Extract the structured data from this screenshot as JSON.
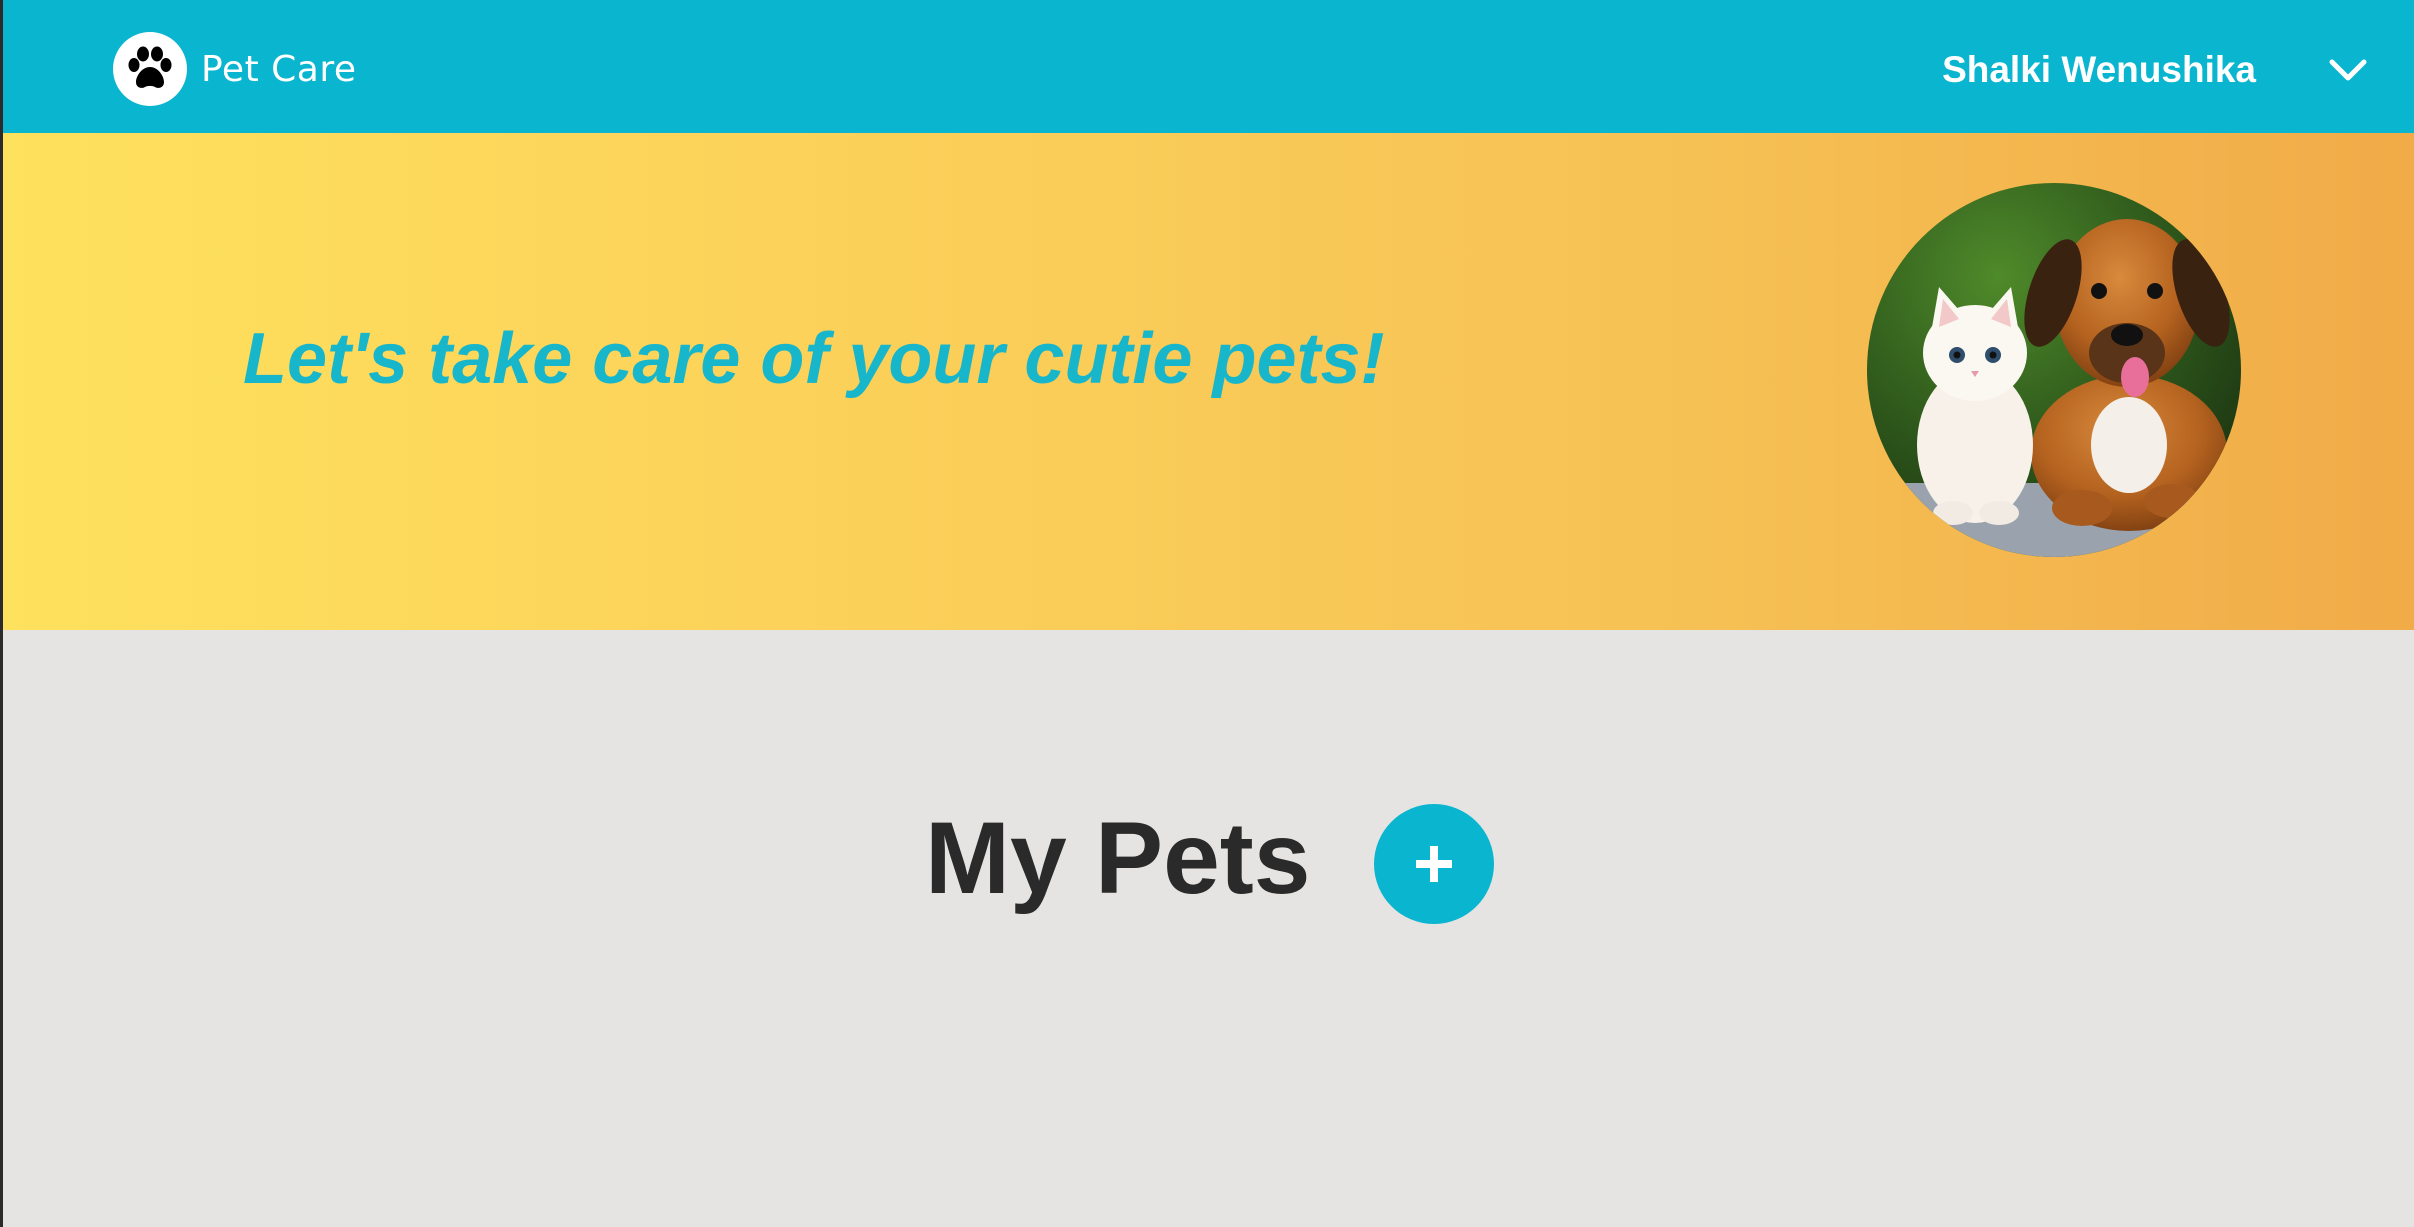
{
  "header": {
    "brand_name": "Pet Care",
    "logo_icon": "paw-icon",
    "user_name": "Shalki Wenushika",
    "menu_icon": "chevron-down-icon"
  },
  "hero": {
    "tagline": "Let's take care of your cutie pets!",
    "image_subject": "kitten and puppy photo"
  },
  "main": {
    "section_title": "My Pets",
    "add_icon": "plus-icon"
  },
  "colors": {
    "brand": "#0ab5cf",
    "hero_gradient_start": "#fee15d",
    "hero_gradient_end": "#f1ab48",
    "page_background": "#e5e4e2",
    "title_text": "#2a2a2a"
  }
}
